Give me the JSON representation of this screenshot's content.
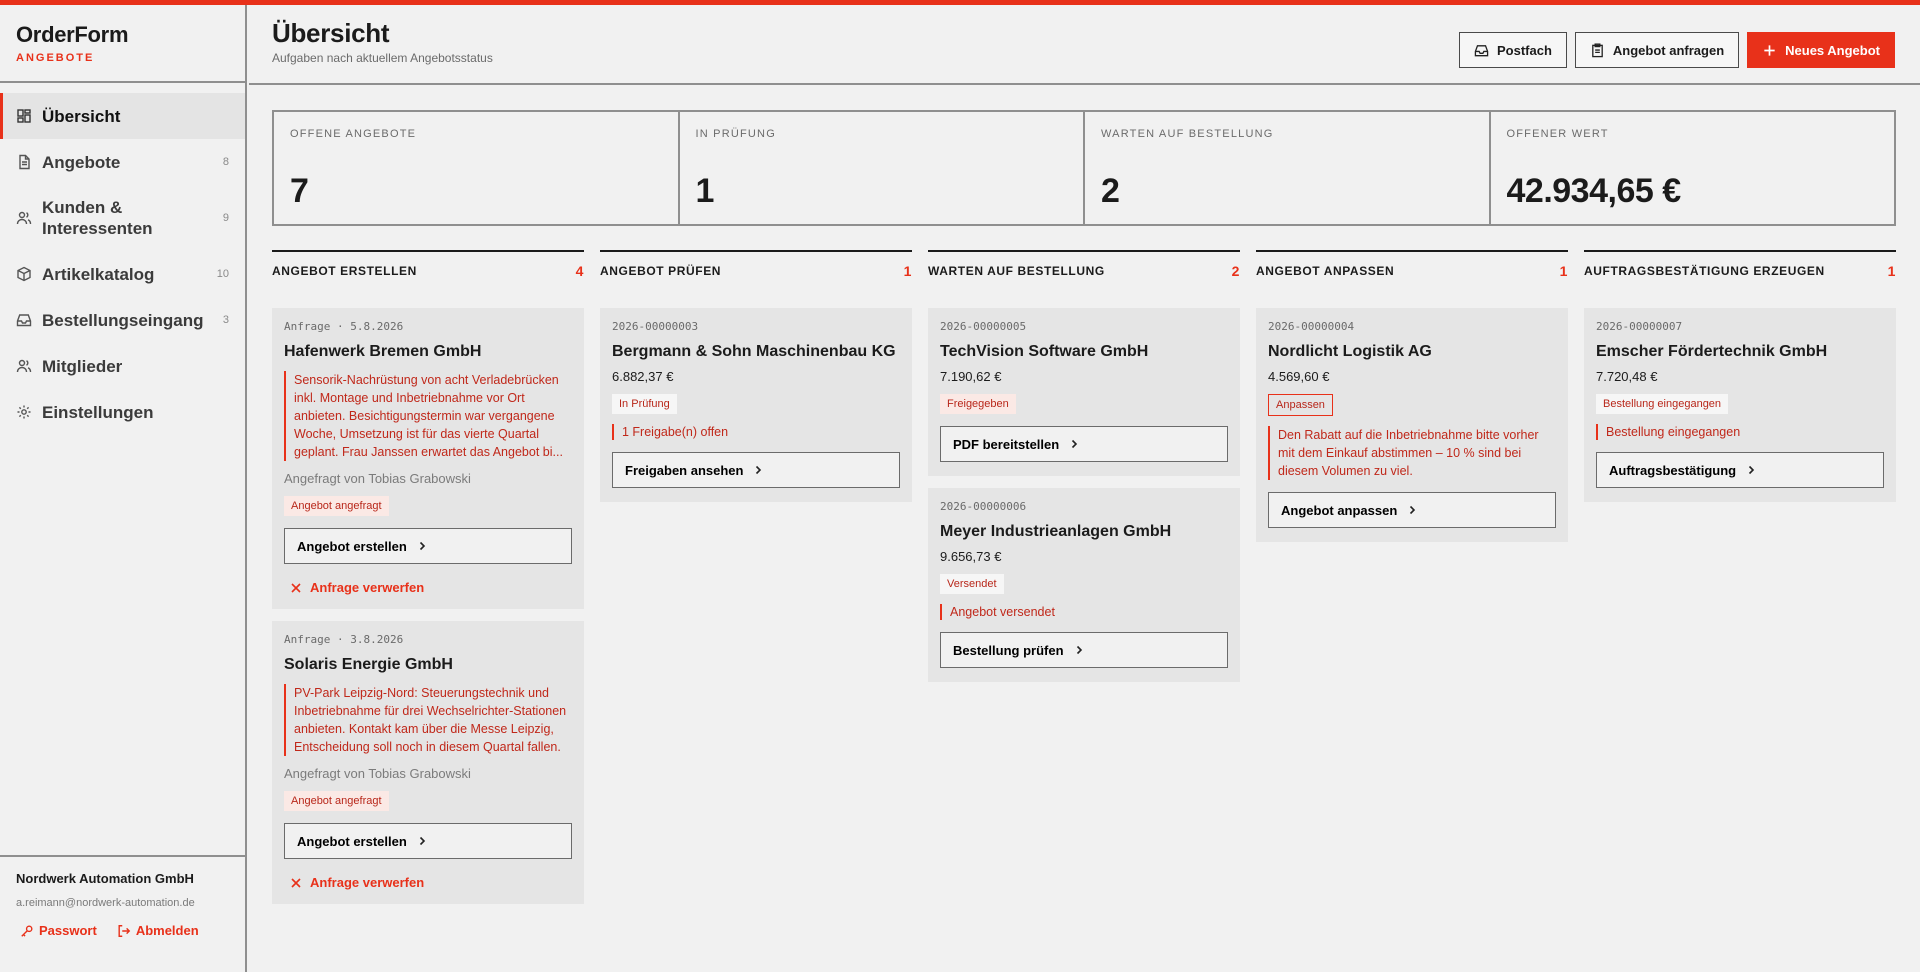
{
  "app": {
    "name": "OrderForm",
    "subtitle": "ANGEBOTE",
    "accent": "#e8311a"
  },
  "sidebar": {
    "items": [
      {
        "label": "Übersicht",
        "count": "",
        "icon": "dashboard-icon"
      },
      {
        "label": "Angebote",
        "count": "8",
        "icon": "document-icon"
      },
      {
        "label": "Kunden & Interessenten",
        "count": "9",
        "icon": "users-icon"
      },
      {
        "label": "Artikelkatalog",
        "count": "10",
        "icon": "box-icon"
      },
      {
        "label": "Bestellungseingang",
        "count": "3",
        "icon": "inbox-icon"
      },
      {
        "label": "Mitglieder",
        "count": "",
        "icon": "users-icon"
      },
      {
        "label": "Einstellungen",
        "count": "",
        "icon": "gear-icon"
      }
    ],
    "footer": {
      "org": "Nordwerk Automation GmbH",
      "email": "a.reimann@nordwerk-automation.de",
      "password_label": "Passwort",
      "logout_label": "Abmelden"
    }
  },
  "header": {
    "title": "Übersicht",
    "subtitle": "Aufgaben nach aktuellem Angebotsstatus",
    "inbox_label": "Postfach",
    "request_label": "Angebot anfragen",
    "new_label": "Neues Angebot"
  },
  "stats": [
    {
      "label": "OFFENE ANGEBOTE",
      "value": "7"
    },
    {
      "label": "IN PRÜFUNG",
      "value": "1"
    },
    {
      "label": "WARTEN AUF BESTELLUNG",
      "value": "2"
    },
    {
      "label": "OFFENER WERT",
      "value": "42.934,65 €"
    }
  ],
  "columns": [
    {
      "title": "ANGEBOT ERSTELLEN",
      "count": "4",
      "cards": [
        {
          "meta": "Anfrage · 5.8.2026",
          "title": "Hafenwerk Bremen GmbH",
          "note": "Sensorik-Nachrüstung von acht Verladebrücken inkl. Montage und Inbetriebnahme vor Ort anbieten. Besichtigungstermin war vergangene Woche, Umsetzung ist für das vierte Quartal geplant. Frau Janssen erwartet das Angebot bi...",
          "requested": "Angefragt von Tobias Grabowski",
          "badge": "Angebot angefragt",
          "button": "Angebot erstellen",
          "discard": "Anfrage verwerfen"
        },
        {
          "meta": "Anfrage · 3.8.2026",
          "title": "Solaris Energie GmbH",
          "note": "PV-Park Leipzig-Nord: Steuerungstechnik und Inbetriebnahme für drei Wechselrichter-Stationen anbieten. Kontakt kam über die Messe Leipzig, Entscheidung soll noch in diesem Quartal fallen.",
          "requested": "Angefragt von Tobias Grabowski",
          "badge": "Angebot angefragt",
          "button": "Angebot erstellen",
          "discard": "Anfrage verwerfen"
        }
      ]
    },
    {
      "title": "ANGEBOT PRÜFEN",
      "count": "1",
      "cards": [
        {
          "meta": "2026-00000003",
          "title": "Bergmann & Sohn Maschinenbau KG",
          "amount": "6.882,37 €",
          "badge": "In Prüfung",
          "status": "1 Freigabe(n) offen",
          "button": "Freigaben ansehen"
        }
      ]
    },
    {
      "title": "WARTEN AUF BESTELLUNG",
      "count": "2",
      "cards": [
        {
          "meta": "2026-00000005",
          "title": "TechVision Software GmbH",
          "amount": "7.190,62 €",
          "badge": "Freigegeben",
          "button": "PDF bereitstellen"
        },
        {
          "meta": "2026-00000006",
          "title": "Meyer Industrieanlagen GmbH",
          "amount": "9.656,73 €",
          "badge": "Versendet",
          "status": "Angebot versendet",
          "button": "Bestellung prüfen"
        }
      ]
    },
    {
      "title": "ANGEBOT ANPASSEN",
      "count": "1",
      "cards": [
        {
          "meta": "2026-00000004",
          "title": "Nordlicht Logistik AG",
          "amount": "4.569,60 €",
          "badge": "Anpassen",
          "status": "Den Rabatt auf die Inbetriebnahme bitte vorher mit dem Einkauf abstimmen – 10 % sind bei diesem Volumen zu viel.",
          "button": "Angebot anpassen"
        }
      ]
    },
    {
      "title": "AUFTRAGSBESTÄTIGUNG ERZEUGEN",
      "count": "1",
      "cards": [
        {
          "meta": "2026-00000007",
          "title": "Emscher Fördertechnik GmbH",
          "amount": "7.720,48 €",
          "badge": "Bestellung eingegangen",
          "status": "Bestellung eingegangen",
          "button": "Auftragsbestätigung"
        }
      ]
    }
  ]
}
